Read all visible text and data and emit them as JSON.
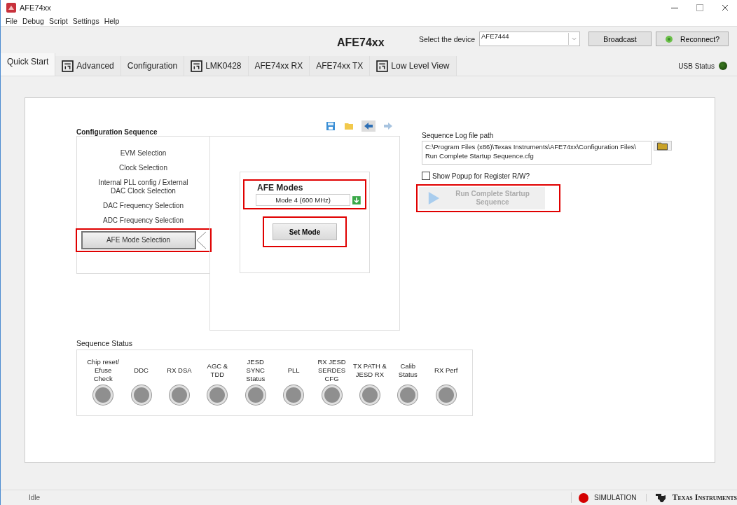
{
  "window": {
    "title": "AFE74xx"
  },
  "menu": [
    "File",
    "Debug",
    "Script",
    "Settings",
    "Help"
  ],
  "header": {
    "title": "AFE74xx",
    "device_label": "Select the device",
    "device_value": "AFE7444",
    "broadcast": "Broadcast",
    "reconnect": "Reconnect?"
  },
  "tabs": [
    {
      "label": "Quick Start",
      "selected": true,
      "icon": false
    },
    {
      "label": "Advanced",
      "selected": false,
      "icon": true
    },
    {
      "label": "Configuration",
      "selected": false,
      "icon": false
    },
    {
      "label": "LMK0428",
      "selected": false,
      "icon": true
    },
    {
      "label": "AFE74xx RX",
      "selected": false,
      "icon": false
    },
    {
      "label": "AFE74xx TX",
      "selected": false,
      "icon": false
    },
    {
      "label": "Low Level View",
      "selected": false,
      "icon": true
    }
  ],
  "usb_status": "USB Status",
  "config_sequence": {
    "title": "Configuration Sequence",
    "steps": [
      {
        "label": "EVM Selection",
        "selected": false,
        "highlighted": false
      },
      {
        "label": "Clock Selection",
        "selected": false,
        "highlighted": false
      },
      {
        "label": "Internal PLL config / External DAC Clock Selection",
        "selected": false,
        "highlighted": false
      },
      {
        "label": "DAC Frequency Selection",
        "selected": false,
        "highlighted": false
      },
      {
        "label": "ADC Frequency Selection",
        "selected": false,
        "highlighted": false
      },
      {
        "label": "AFE Mode Selection",
        "selected": true,
        "highlighted": true
      }
    ]
  },
  "afe_modes": {
    "title": "AFE Modes",
    "value": "Mode 4 (600 MHz)",
    "highlighted": true,
    "set_button": "Set Mode",
    "set_highlighted": true
  },
  "log": {
    "label": "Sequence Log file path",
    "path": "C:\\Program Files (x86)\\Texas Instruments\\AFE74xx\\Configuration Files\\ Run Complete Startup Sequence.cfg",
    "popup_label": "Show Popup for Register R/W?",
    "popup_checked": false,
    "run_button": "Run Complete Startup Sequence",
    "run_disabled": true,
    "run_highlighted": true
  },
  "sequence_status": {
    "title": "Sequence Status",
    "items": [
      "Chip reset/ Efuse Check",
      "DDC",
      "RX DSA",
      "AGC & TDD",
      "JESD SYNC Status",
      "PLL",
      "RX JESD SERDES CFG",
      "TX PATH & JESD RX",
      "Calib Status",
      "RX Perf"
    ]
  },
  "status_bar": {
    "state": "Idle",
    "mode": "SIMULATION",
    "brand": "Texas Instruments"
  }
}
